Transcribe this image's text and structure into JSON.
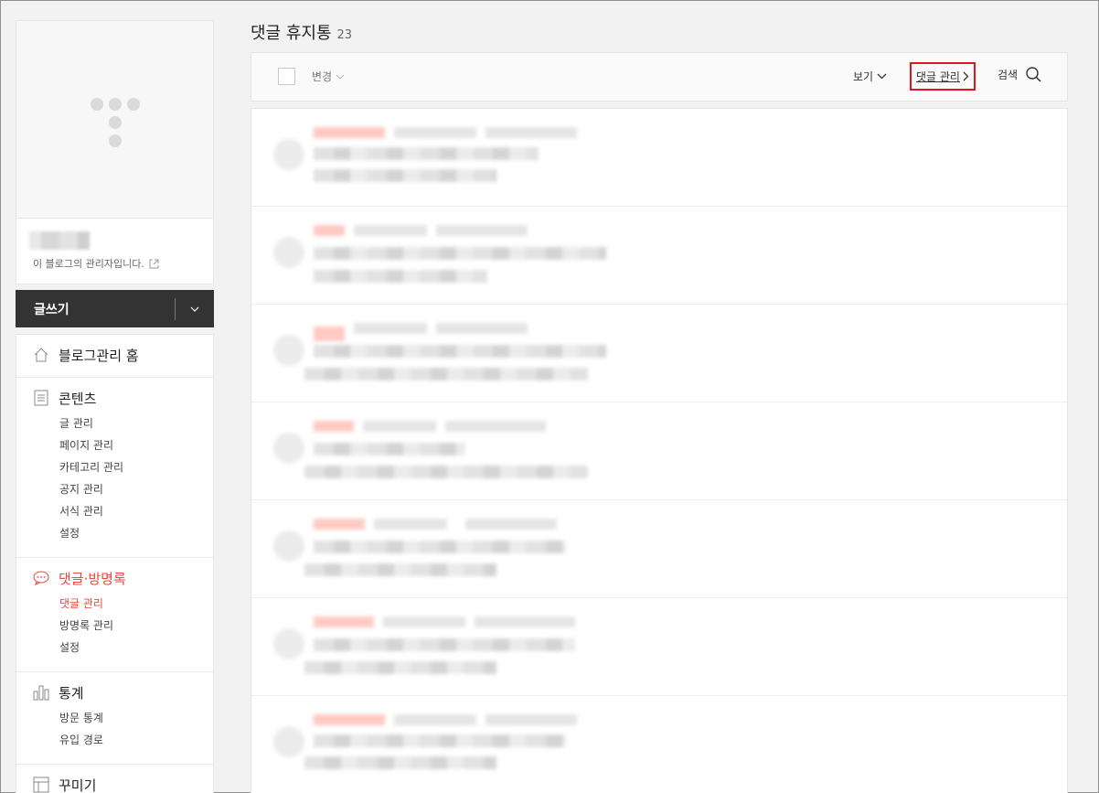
{
  "sidebar": {
    "admin_note": "이 블로그의 관리자입니다.",
    "write_label": "글쓰기",
    "menu": {
      "home": "블로그관리 홈",
      "contents": {
        "title": "콘텐츠",
        "items": [
          "글 관리",
          "페이지 관리",
          "카테고리 관리",
          "공지 관리",
          "서식 관리",
          "설정"
        ]
      },
      "comments": {
        "title": "댓글·방명록",
        "items": [
          "댓글 관리",
          "방명록 관리",
          "설정"
        ]
      },
      "stats": {
        "title": "통계",
        "items": [
          "방문 통계",
          "유입 경로"
        ]
      },
      "decorate": {
        "title": "꾸미기"
      }
    }
  },
  "main": {
    "title": "댓글 휴지통",
    "count": "23",
    "toolbar": {
      "change_label": "변경",
      "view_label": "보기",
      "comment_manage_label": "댓글 관리",
      "search_label": "검색"
    }
  },
  "colors": {
    "accent": "#e8473b",
    "highlight_border": "#e0161b",
    "write_bar": "#333333"
  }
}
